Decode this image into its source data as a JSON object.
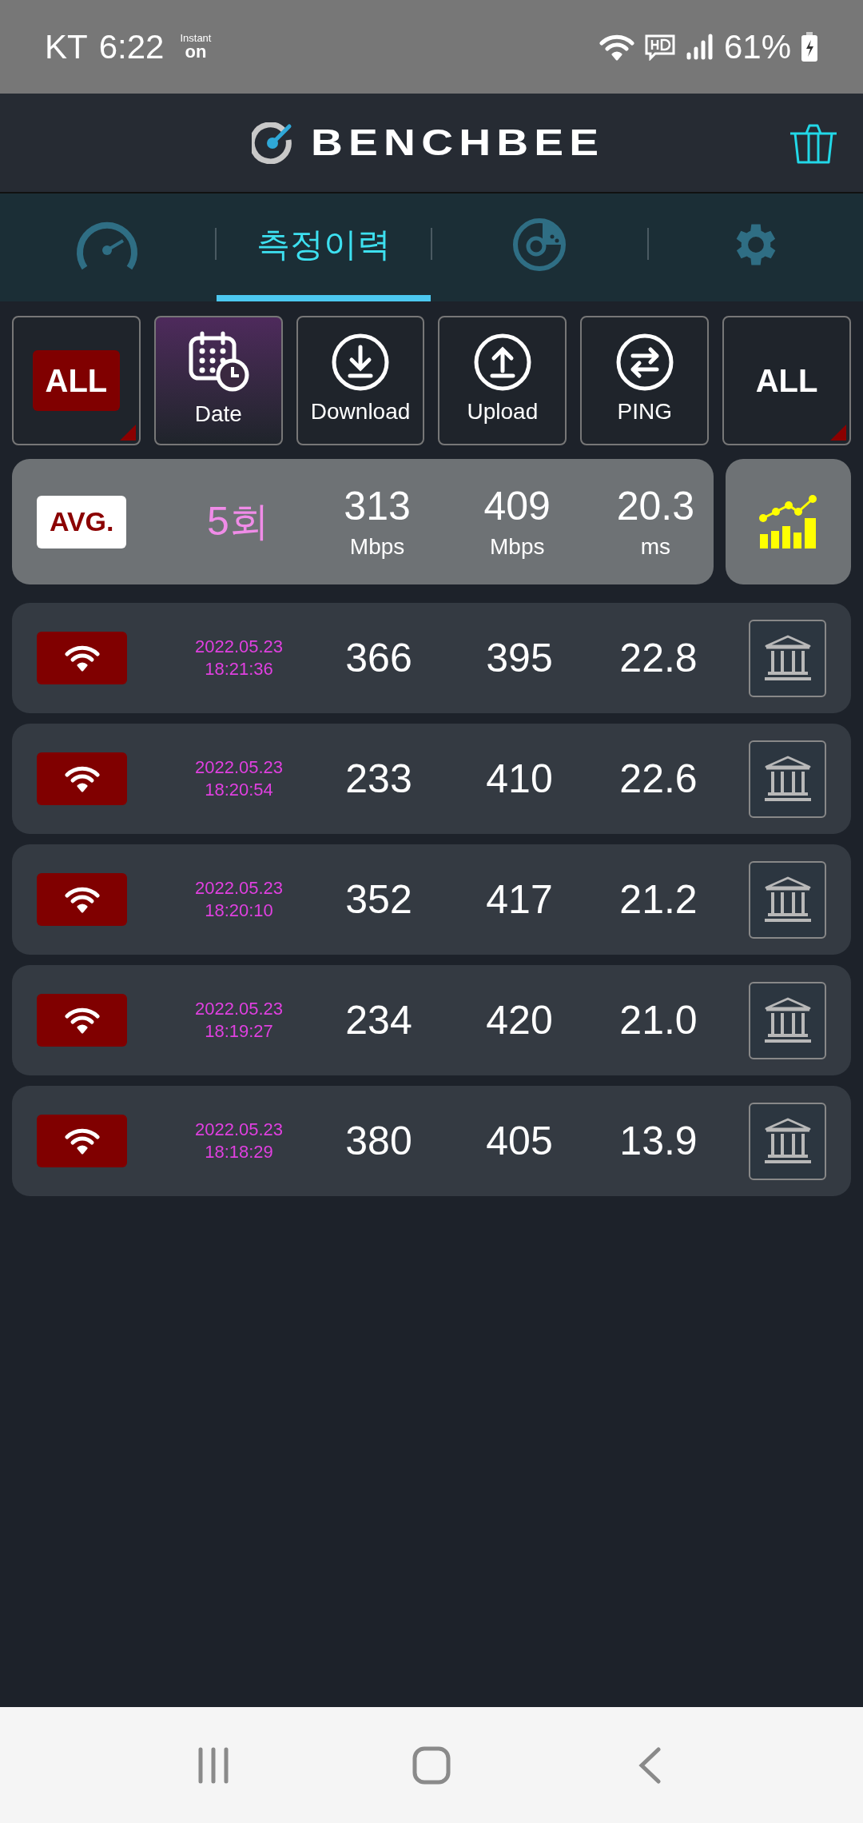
{
  "status_bar": {
    "carrier": "KT",
    "time": "6:22",
    "instant": "Instant",
    "on": "on",
    "battery": "61%"
  },
  "header": {
    "logo": "BENCHBEE"
  },
  "tabs": [
    {
      "kind": "speedometer",
      "selected": false
    },
    {
      "kind": "text",
      "label": "측정이력",
      "selected": true
    },
    {
      "kind": "chart",
      "selected": false
    },
    {
      "kind": "gear",
      "selected": false
    }
  ],
  "filters": [
    {
      "kind": "badge",
      "label": "ALL",
      "selected": false
    },
    {
      "kind": "date",
      "label": "Date",
      "selected": true
    },
    {
      "kind": "download",
      "label": "Download",
      "selected": false
    },
    {
      "kind": "upload",
      "label": "Upload",
      "selected": false
    },
    {
      "kind": "ping",
      "label": "PING",
      "selected": false
    },
    {
      "kind": "plain",
      "label": "ALL",
      "selected": false
    }
  ],
  "average": {
    "badge": "AVG.",
    "count": "5회",
    "download": "313",
    "download_unit": "Mbps",
    "upload": "409",
    "upload_unit": "Mbps",
    "ping": "20.3",
    "ping_unit": "ms"
  },
  "rows": [
    {
      "date": "2022.05.23",
      "time": "18:21:36",
      "download": "366",
      "upload": "395",
      "ping": "22.8"
    },
    {
      "date": "2022.05.23",
      "time": "18:20:54",
      "download": "233",
      "upload": "410",
      "ping": "22.6"
    },
    {
      "date": "2022.05.23",
      "time": "18:20:10",
      "download": "352",
      "upload": "417",
      "ping": "21.2"
    },
    {
      "date": "2022.05.23",
      "time": "18:19:27",
      "download": "234",
      "upload": "420",
      "ping": "21.0"
    },
    {
      "date": "2022.05.23",
      "time": "18:18:29",
      "download": "380",
      "upload": "405",
      "ping": "13.9"
    }
  ]
}
